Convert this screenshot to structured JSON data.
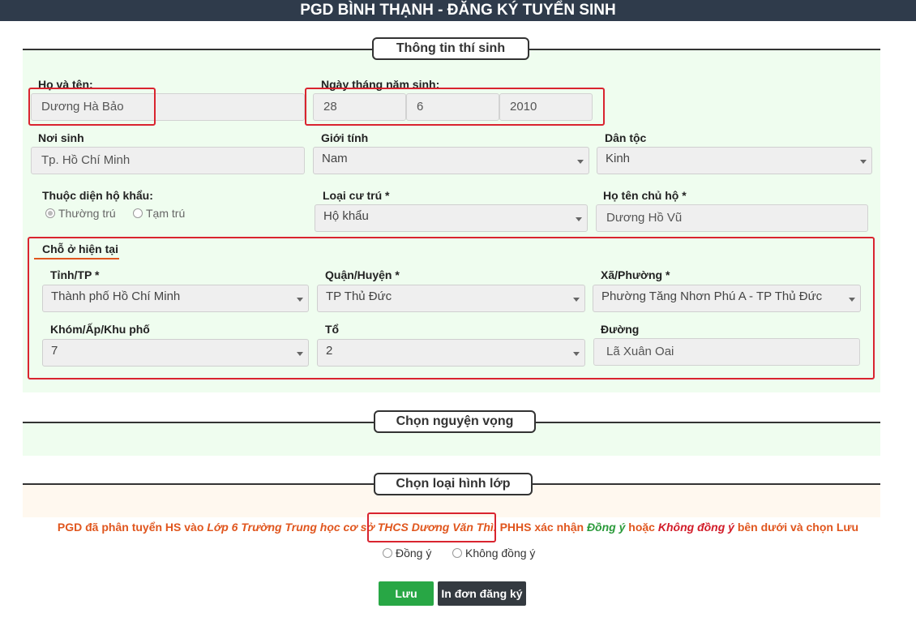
{
  "header": {
    "title": "PGD BÌNH THẠNH - ĐĂNG KÝ TUYỂN SINH"
  },
  "sections": {
    "student_info": "Thông tin thí sinh",
    "choose_wish": "Chọn nguyện vọng",
    "choose_class_type": "Chọn loại hình lớp"
  },
  "student": {
    "name_label": "Họ và tên:",
    "name": "Dương Hà Bảo",
    "dob_label": "Ngày tháng năm sinh:",
    "dob_day": "28",
    "dob_month": "6",
    "dob_year": "2010",
    "birthplace_label": "Nơi sinh",
    "birthplace": "Tp. Hồ Chí Minh",
    "gender_label": "Giới tính",
    "gender": "Nam",
    "ethnicity_label": "Dân tộc",
    "ethnicity": "Kinh",
    "household_type_label": "Thuộc diện hộ khẩu:",
    "household_options": [
      "Thường trú",
      "Tạm trú"
    ],
    "household_selected": "Thường trú",
    "residence_type_label": "Loại cư trú *",
    "residence_type": "Hộ khẩu",
    "head_name_label": "Họ tên chủ hộ *",
    "head_name": "Dương Hồ Vũ"
  },
  "address": {
    "heading": "Chỗ ở hiện tại",
    "province_label": "Tỉnh/TP *",
    "province": "Thành phố Hồ Chí Minh",
    "district_label": "Quận/Huyện *",
    "district": "TP Thủ Đức",
    "ward_label": "Xã/Phường *",
    "ward": "Phường Tăng Nhơn Phú A - TP Thủ Đức",
    "hamlet_label": "Khóm/Ấp/Khu phố",
    "hamlet": "7",
    "group_label": "Tổ",
    "group": "2",
    "street_label": "Đường",
    "street": "Lã Xuân Oai"
  },
  "notice": {
    "part1": "PGD đã phân tuyển HS vào",
    "part2": "Lớp 6 Trường Trung học cơ sở",
    "school": "THCS Dương Văn Thì.",
    "part3": "PHHS xác nhận",
    "agree": "Đồng ý",
    "part4": "hoặc",
    "disagree": "Không đồng ý",
    "part5": "bên dưới và chọn Lưu"
  },
  "confirm_options": {
    "agree": "Đồng ý",
    "disagree": "Không đồng ý"
  },
  "buttons": {
    "save": "Lưu",
    "print": "In đơn đăng ký"
  },
  "colors": {
    "header_bg": "#2f3b4b",
    "highlight": "#d9242f",
    "save": "#28a745",
    "print": "#343a40"
  }
}
